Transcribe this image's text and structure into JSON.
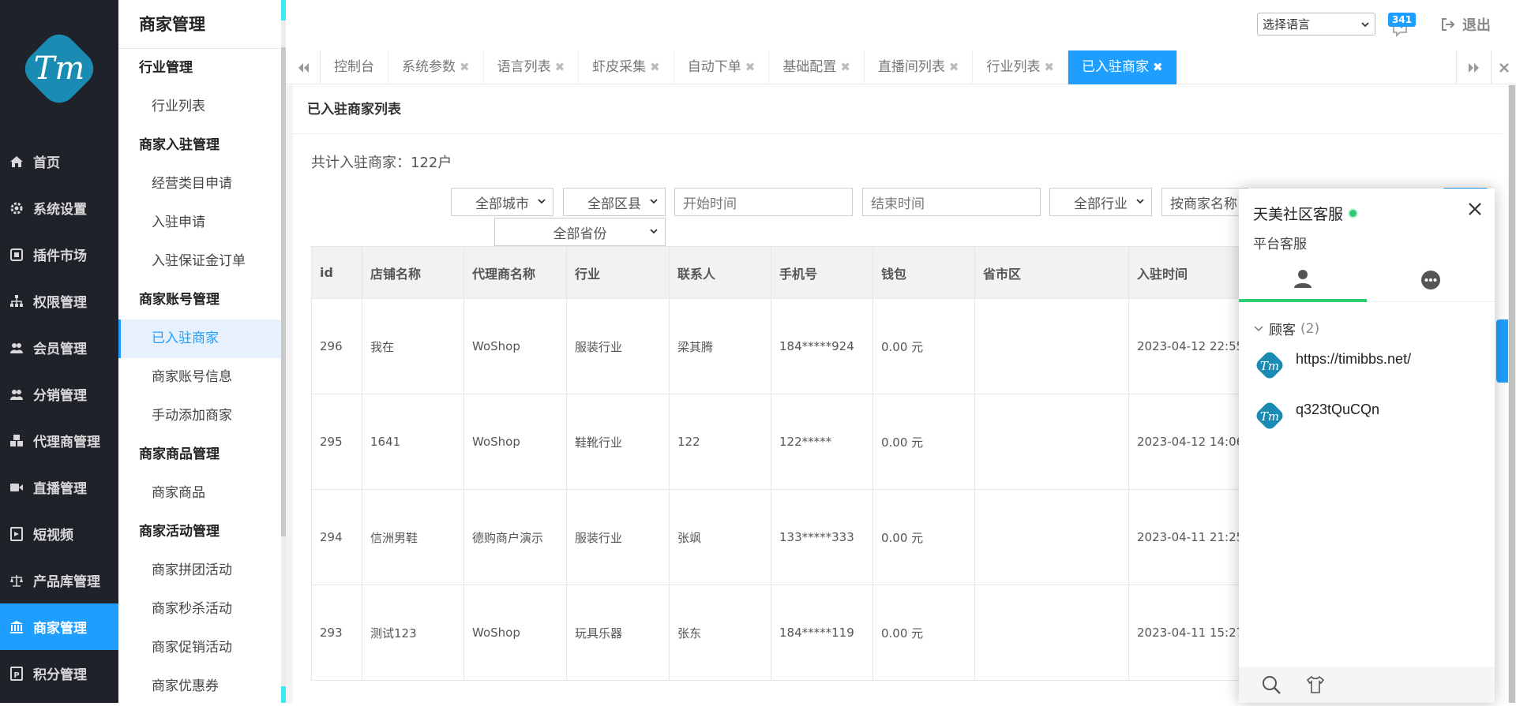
{
  "nav": {
    "logo_text": "Tm",
    "items": [
      {
        "label": "首页",
        "icon": "home-icon"
      },
      {
        "label": "系统设置",
        "icon": "gear-icon"
      },
      {
        "label": "插件市场",
        "icon": "plugin-icon"
      },
      {
        "label": "权限管理",
        "icon": "sitemap-icon"
      },
      {
        "label": "会员管理",
        "icon": "users-icon"
      },
      {
        "label": "分销管理",
        "icon": "users-icon"
      },
      {
        "label": "代理商管理",
        "icon": "cubes-icon"
      },
      {
        "label": "直播管理",
        "icon": "video-icon"
      },
      {
        "label": "短视频",
        "icon": "film-icon"
      },
      {
        "label": "产品库管理",
        "icon": "balance-icon"
      },
      {
        "label": "商家管理",
        "icon": "bank-icon"
      },
      {
        "label": "积分管理",
        "icon": "points-icon"
      }
    ],
    "active_index": 10
  },
  "submenu": {
    "title": "商家管理",
    "g1": "行业管理",
    "g1_i1": "行业列表",
    "g2": "商家入驻管理",
    "g2_i1": "经营类目申请",
    "g2_i2": "入驻申请",
    "g2_i3": "入驻保证金订单",
    "g3": "商家账号管理",
    "g3_i1": "已入驻商家",
    "g3_i2": "商家账号信息",
    "g3_i3": "手动添加商家",
    "g4": "商家商品管理",
    "g4_i1": "商家商品",
    "g5": "商家活动管理",
    "g5_i1": "商家拼团活动",
    "g5_i2": "商家秒杀活动",
    "g5_i3": "商家促销活动",
    "g5_i4": "商家优惠券"
  },
  "header": {
    "language_select": "选择语言",
    "message_count": "341",
    "logout_label": "退出"
  },
  "tabs": [
    {
      "label": "控制台",
      "closable": false
    },
    {
      "label": "系统参数",
      "closable": true
    },
    {
      "label": "语言列表",
      "closable": true
    },
    {
      "label": "虾皮采集",
      "closable": true
    },
    {
      "label": "自动下单",
      "closable": true
    },
    {
      "label": "基础配置",
      "closable": true
    },
    {
      "label": "直播间列表",
      "closable": true
    },
    {
      "label": "行业列表",
      "closable": true
    },
    {
      "label": "已入驻商家",
      "closable": true
    }
  ],
  "panel": {
    "title": "已入驻商家列表",
    "total_text": "共计入驻商家：122户"
  },
  "filters": {
    "city": "全部城市",
    "district": "全部区县",
    "start_placeholder": "开始时间",
    "end_placeholder": "结束时间",
    "industry": "全部行业",
    "search_name": "按商家名称",
    "province": "全部省份"
  },
  "table": {
    "headers": [
      "id",
      "店铺名称",
      "代理商名称",
      "行业",
      "联系人",
      "手机号",
      "钱包",
      "省市区",
      "入驻时间"
    ],
    "rows": [
      [
        "296",
        "我在",
        "WoShop",
        "服装行业",
        "梁其腾",
        "184*****924",
        "0.00 元",
        "",
        "2023-04-12 22:55"
      ],
      [
        "295",
        "1641",
        "WoShop",
        "鞋靴行业",
        "122",
        "122*****",
        "0.00 元",
        "",
        "2023-04-12 14:06"
      ],
      [
        "294",
        "信洲男鞋",
        "德购商户演示",
        "服装行业",
        "张飒",
        "133*****333",
        "0.00 元",
        "",
        "2023-04-11 21:25"
      ],
      [
        "293",
        "测试123",
        "WoShop",
        "玩具乐器",
        "张东",
        "184*****119",
        "0.00 元",
        "",
        "2023-04-11 15:27"
      ]
    ]
  },
  "chat": {
    "title": "天美社区客服",
    "subtitle": "平台客服",
    "group_label": "顾客",
    "group_count": "(2)",
    "contacts": [
      "https://timibbs.net/",
      "q323tQuCQn"
    ]
  },
  "colors": {
    "accent": "#1e9fff",
    "nav_bg": "#20222a",
    "online": "#2ecc71",
    "logo": "#1a8bb3"
  }
}
